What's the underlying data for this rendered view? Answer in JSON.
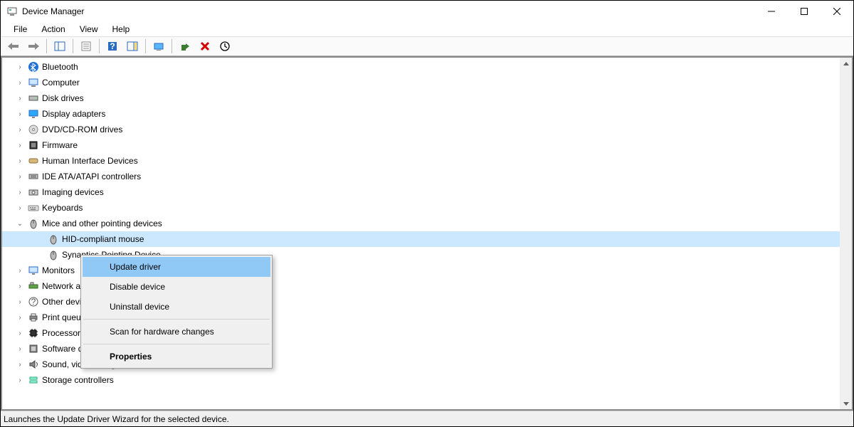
{
  "window": {
    "title": "Device Manager"
  },
  "menubar": {
    "file": "File",
    "action": "Action",
    "view": "View",
    "help": "Help"
  },
  "toolbar": {
    "back": "Back",
    "forward": "Forward",
    "show_hide": "Show/Hide Console Tree",
    "properties_sheet": "Properties",
    "help": "Help",
    "actions_pane": "Show/Hide Action Pane",
    "update_driver": "Update Device Driver",
    "enable": "Enable Device",
    "uninstall": "Uninstall Device",
    "scan": "Scan for hardware changes"
  },
  "tree": [
    {
      "label": "Bluetooth",
      "expanded": false,
      "icon": "bluetooth"
    },
    {
      "label": "Computer",
      "expanded": false,
      "icon": "computer"
    },
    {
      "label": "Disk drives",
      "expanded": false,
      "icon": "disk"
    },
    {
      "label": "Display adapters",
      "expanded": false,
      "icon": "display"
    },
    {
      "label": "DVD/CD-ROM drives",
      "expanded": false,
      "icon": "dvd"
    },
    {
      "label": "Firmware",
      "expanded": false,
      "icon": "firmware"
    },
    {
      "label": "Human Interface Devices",
      "expanded": false,
      "icon": "hid"
    },
    {
      "label": "IDE ATA/ATAPI controllers",
      "expanded": false,
      "icon": "ide"
    },
    {
      "label": "Imaging devices",
      "expanded": false,
      "icon": "imaging"
    },
    {
      "label": "Keyboards",
      "expanded": false,
      "icon": "keyboard"
    },
    {
      "label": "Mice and other pointing devices",
      "expanded": true,
      "icon": "mouse",
      "children": [
        {
          "label": "HID-compliant mouse",
          "icon": "mouse",
          "selected": true
        },
        {
          "label": "Synaptics Pointing Device",
          "icon": "mouse"
        }
      ]
    },
    {
      "label": "Monitors",
      "expanded": false,
      "icon": "monitor"
    },
    {
      "label": "Network adapters",
      "expanded": false,
      "icon": "network"
    },
    {
      "label": "Other devices",
      "expanded": false,
      "icon": "other"
    },
    {
      "label": "Print queues",
      "expanded": false,
      "icon": "printer"
    },
    {
      "label": "Processors",
      "expanded": false,
      "icon": "processor"
    },
    {
      "label": "Software devices",
      "expanded": false,
      "icon": "software"
    },
    {
      "label": "Sound, video and game controllers",
      "expanded": false,
      "icon": "sound"
    },
    {
      "label": "Storage controllers",
      "expanded": false,
      "icon": "storage"
    }
  ],
  "context_menu": {
    "update_driver": "Update driver",
    "disable_device": "Disable device",
    "uninstall_device": "Uninstall device",
    "scan": "Scan for hardware changes",
    "properties": "Properties"
  },
  "statusbar": {
    "text": "Launches the Update Driver Wizard for the selected device."
  }
}
